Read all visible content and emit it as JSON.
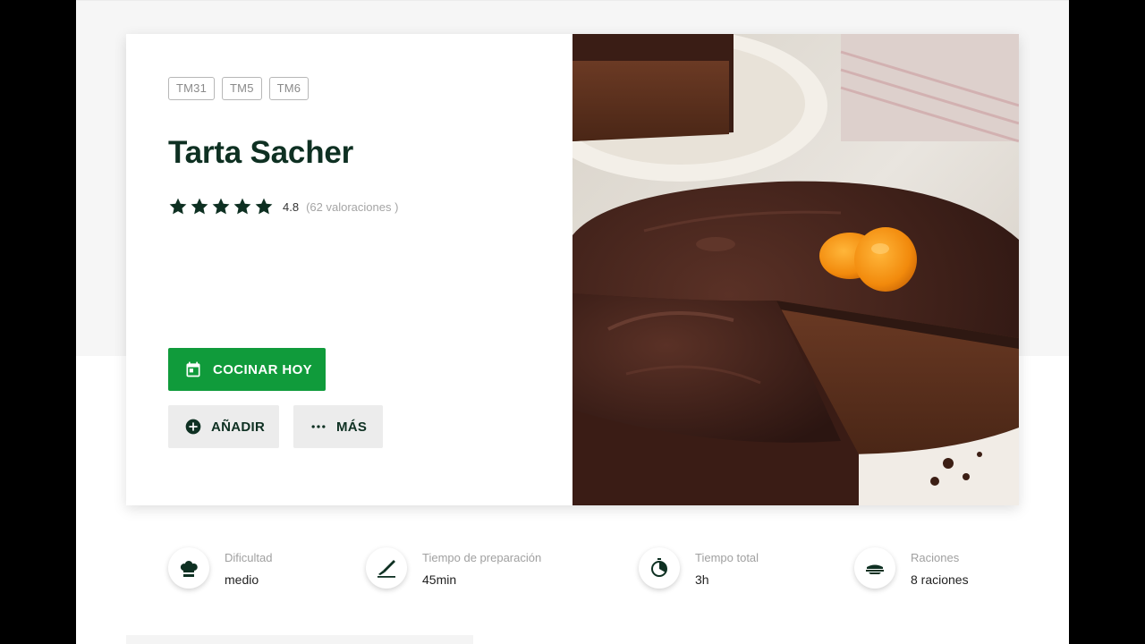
{
  "recipe": {
    "tags": [
      "TM31",
      "TM5",
      "TM6"
    ],
    "title": "Tarta Sacher",
    "rating_value": "4.8",
    "rating_count": "(62 valoraciones )",
    "stars": 5
  },
  "actions": {
    "cook_today": "COCINAR HOY",
    "add": "AÑADIR",
    "more": "MÁS"
  },
  "info": [
    {
      "label": "Dificultad",
      "value": "medio",
      "icon": "chef-hat-icon"
    },
    {
      "label": "Tiempo de preparación",
      "value": "45min",
      "icon": "knife-icon"
    },
    {
      "label": "Tiempo total",
      "value": "3h",
      "icon": "timer-icon"
    },
    {
      "label": "Raciones",
      "value": "8 raciones",
      "icon": "servings-icon"
    }
  ],
  "colors": {
    "brand_green": "#109b3b",
    "title_dark_green": "#0e3022"
  }
}
